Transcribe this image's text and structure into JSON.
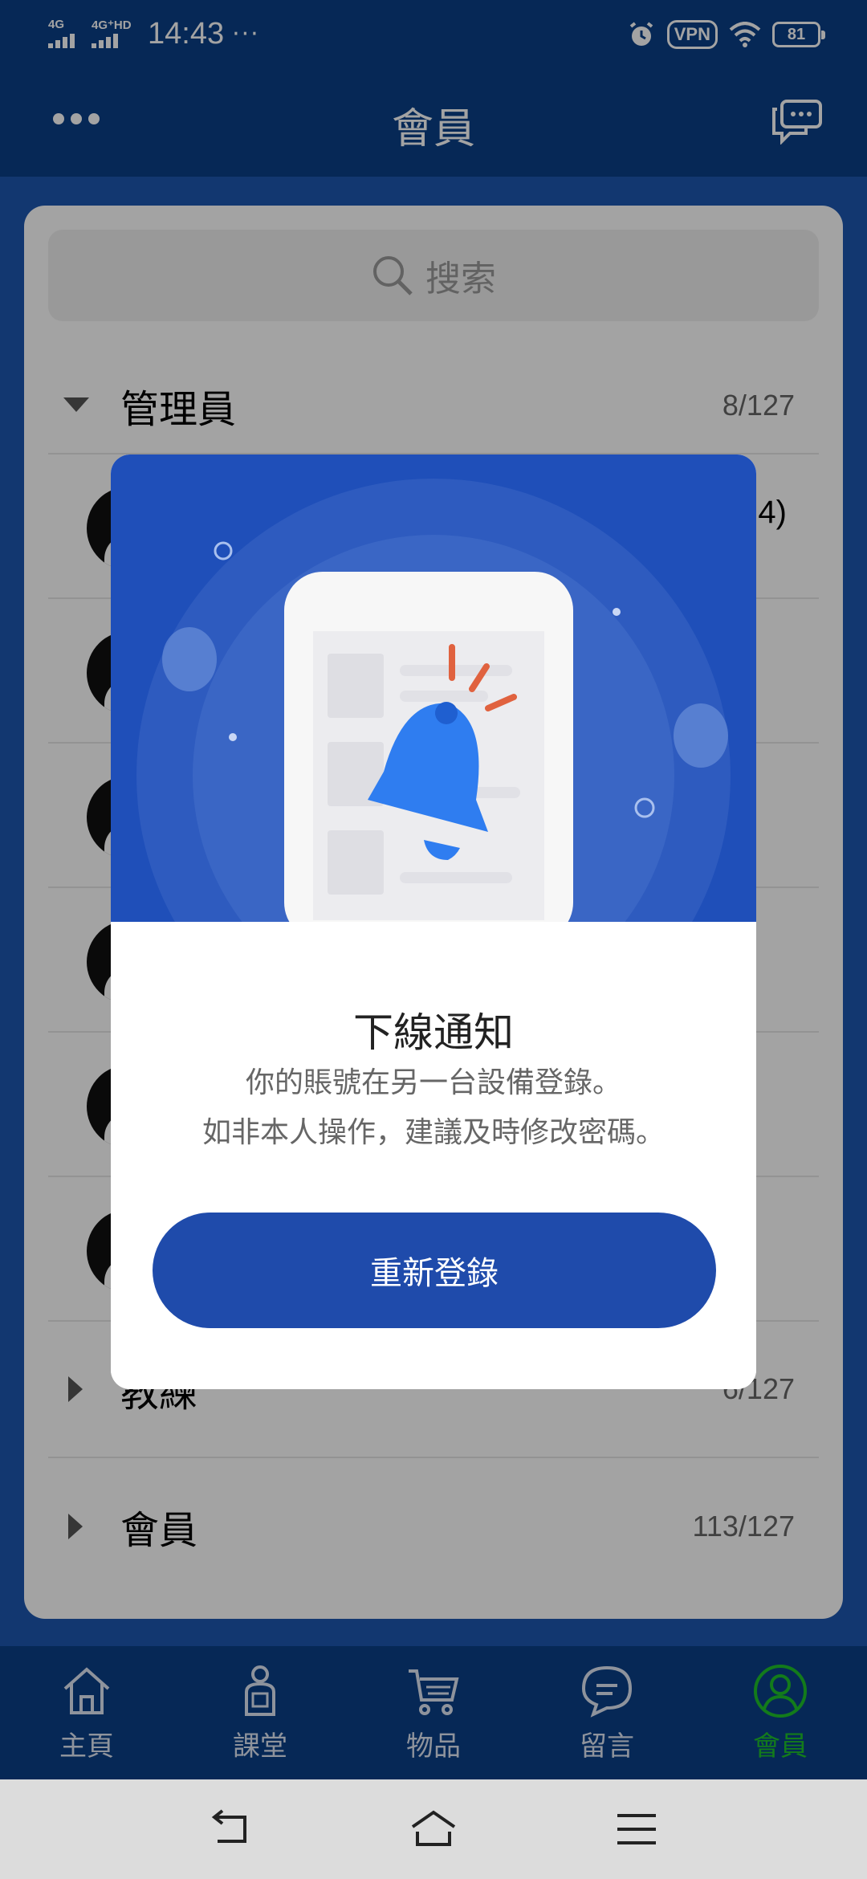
{
  "status_bar": {
    "network_1": "4G",
    "network_2": "4G⁺HD",
    "time": "14:43",
    "more": "···",
    "vpn": "VPN",
    "battery": "81"
  },
  "header": {
    "title": "會員",
    "left_icon": "more-dots-icon",
    "right_icon": "chat-bubbles-icon"
  },
  "search": {
    "placeholder": "搜索"
  },
  "groups": [
    {
      "name": "管理員",
      "count": "8/127",
      "expanded": true
    },
    {
      "name": "教練",
      "count": "6/127",
      "expanded": false
    },
    {
      "name": "會員",
      "count": "113/127",
      "expanded": false
    }
  ],
  "member_partial_text": "4)",
  "bottom_nav": [
    {
      "label": "主頁",
      "icon": "home-icon",
      "active": false
    },
    {
      "label": "課堂",
      "icon": "coach-icon",
      "active": false
    },
    {
      "label": "物品",
      "icon": "cart-icon",
      "active": false
    },
    {
      "label": "留言",
      "icon": "message-icon",
      "active": false
    },
    {
      "label": "會員",
      "icon": "member-icon",
      "active": true
    }
  ],
  "colors": {
    "primary": "#0a3f87",
    "dialog_hero": "#1f4fb9",
    "button": "#1f4bab",
    "active_nav": "#1fc12b",
    "bell": "#2f7df0",
    "bell_rays": "#e0623f"
  },
  "dialog": {
    "title": "下線通知",
    "message_line1": "你的賬號在另一台設備登錄。",
    "message_line2": "如非本人操作，建議及時修改密碼。",
    "button": "重新登錄",
    "illustration_icon": "bell-icon"
  }
}
